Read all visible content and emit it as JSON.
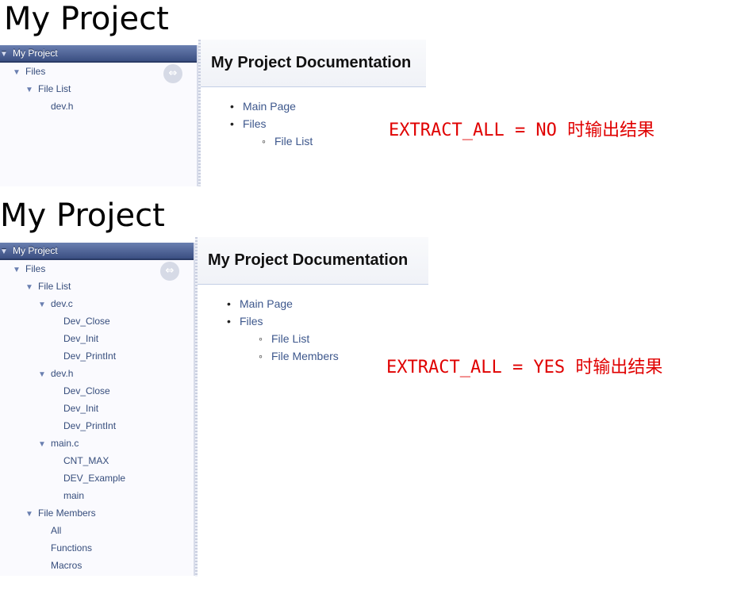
{
  "top": {
    "project_title": "My Project",
    "sync_icon": "sync-arrows-icon",
    "nav": [
      {
        "label": "My Project",
        "depth": 0,
        "arrow": "▼",
        "selected": true
      },
      {
        "label": "Files",
        "depth": 1,
        "arrow": "▼"
      },
      {
        "label": "File List",
        "depth": 2,
        "arrow": "▼"
      },
      {
        "label": "dev.h",
        "depth": 3,
        "arrow": ""
      }
    ],
    "doc_title": "My Project Documentation",
    "doc_links": [
      {
        "label": "Main Page",
        "level": 1
      },
      {
        "label": "Files",
        "level": 1
      },
      {
        "label": "File List",
        "level": 2
      }
    ],
    "annotation": "EXTRACT_ALL = NO 时输出结果"
  },
  "bottom": {
    "project_title": "My Project",
    "sync_icon": "sync-arrows-icon",
    "nav": [
      {
        "label": "My Project",
        "depth": 0,
        "arrow": "▼",
        "selected": true
      },
      {
        "label": "Files",
        "depth": 1,
        "arrow": "▼"
      },
      {
        "label": "File List",
        "depth": 2,
        "arrow": "▼"
      },
      {
        "label": "dev.c",
        "depth": 3,
        "arrow": "▼"
      },
      {
        "label": "Dev_Close",
        "depth": 4,
        "arrow": ""
      },
      {
        "label": "Dev_Init",
        "depth": 4,
        "arrow": ""
      },
      {
        "label": "Dev_PrintInt",
        "depth": 4,
        "arrow": ""
      },
      {
        "label": "dev.h",
        "depth": 3,
        "arrow": "▼"
      },
      {
        "label": "Dev_Close",
        "depth": 4,
        "arrow": ""
      },
      {
        "label": "Dev_Init",
        "depth": 4,
        "arrow": ""
      },
      {
        "label": "Dev_PrintInt",
        "depth": 4,
        "arrow": ""
      },
      {
        "label": "main.c",
        "depth": 3,
        "arrow": "▼"
      },
      {
        "label": "CNT_MAX",
        "depth": 4,
        "arrow": ""
      },
      {
        "label": "DEV_Example",
        "depth": 4,
        "arrow": ""
      },
      {
        "label": "main",
        "depth": 4,
        "arrow": ""
      },
      {
        "label": "File Members",
        "depth": 2,
        "arrow": "▼"
      },
      {
        "label": "All",
        "depth": 3,
        "arrow": ""
      },
      {
        "label": "Functions",
        "depth": 3,
        "arrow": ""
      },
      {
        "label": "Macros",
        "depth": 3,
        "arrow": ""
      }
    ],
    "doc_title": "My Project Documentation",
    "doc_links": [
      {
        "label": "Main Page",
        "level": 1
      },
      {
        "label": "Files",
        "level": 1
      },
      {
        "label": "File List",
        "level": 2
      },
      {
        "label": "File Members",
        "level": 2
      }
    ],
    "annotation": "EXTRACT_ALL = YES 时输出结果"
  }
}
